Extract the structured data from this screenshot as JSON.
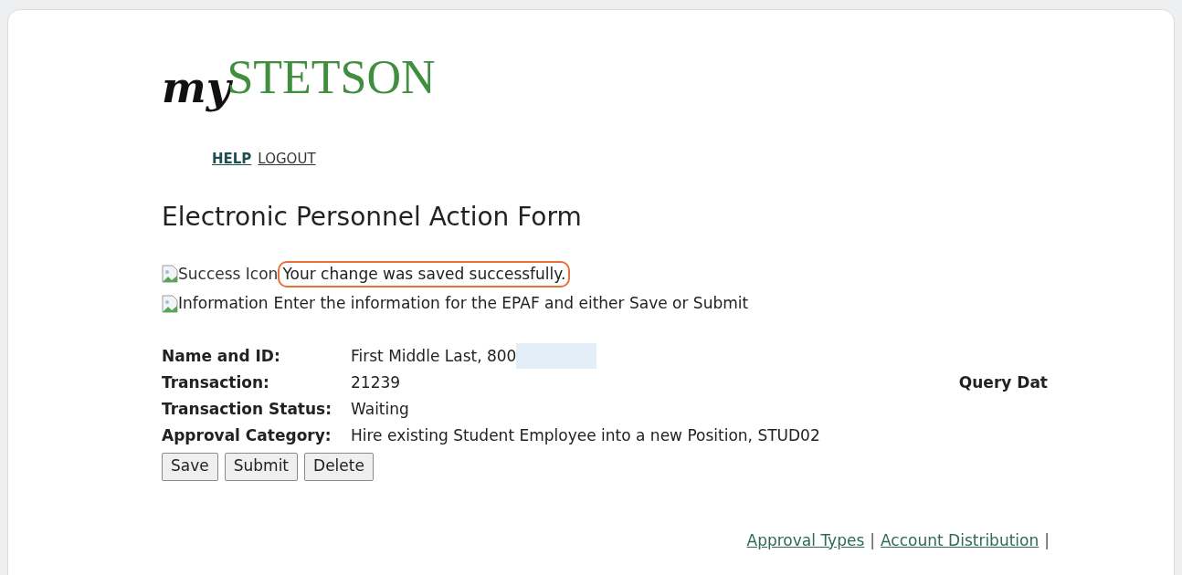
{
  "logo": {
    "script": "my",
    "wordmark": "STETSON"
  },
  "nav_links": [
    "HELP",
    "LOGOUT"
  ],
  "page_title": "Electronic Personnel Action Form",
  "messages": [
    {
      "kind": "success",
      "icon_alt": "Success Icon",
      "text": "Your change was saved successfully.",
      "highlighted": true
    },
    {
      "kind": "info",
      "icon_alt": "Information",
      "text": "Enter the information for the EPAF and either Save or Submit",
      "highlighted": false
    }
  ],
  "details": [
    {
      "label": "Name and ID:",
      "value": "First Middle Last, 800",
      "redacted": true
    },
    {
      "label": "Transaction:",
      "value": "21239",
      "redacted": false,
      "side_label": "Query Dat"
    },
    {
      "label": "Transaction Status:",
      "value": "Waiting",
      "redacted": false
    },
    {
      "label": "Approval Category:",
      "value": "Hire existing Student Employee into a new Position, STUD02",
      "redacted": false
    }
  ],
  "buttons": [
    "Save",
    "Submit",
    "Delete"
  ],
  "footer_links": [
    {
      "label": "Approval Types",
      "separator": "|"
    },
    {
      "label": "Account Distribution",
      "separator": "|"
    }
  ]
}
